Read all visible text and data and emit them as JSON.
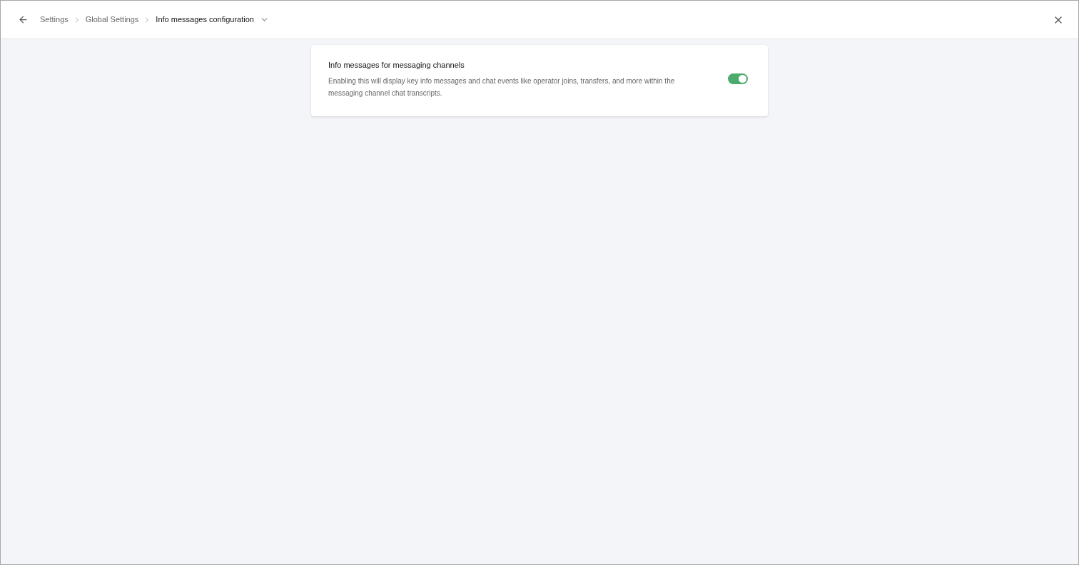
{
  "breadcrumbs": [
    {
      "label": "Settings",
      "current": false
    },
    {
      "label": "Global Settings",
      "current": false
    },
    {
      "label": "Info messages configuration",
      "current": true
    }
  ],
  "settings": [
    {
      "title": "Info messages for messaging channels",
      "description": "Enabling this will display key info messages and chat events like operator joins, transfers, and more within the messaging channel chat transcripts.",
      "on": true
    }
  ]
}
